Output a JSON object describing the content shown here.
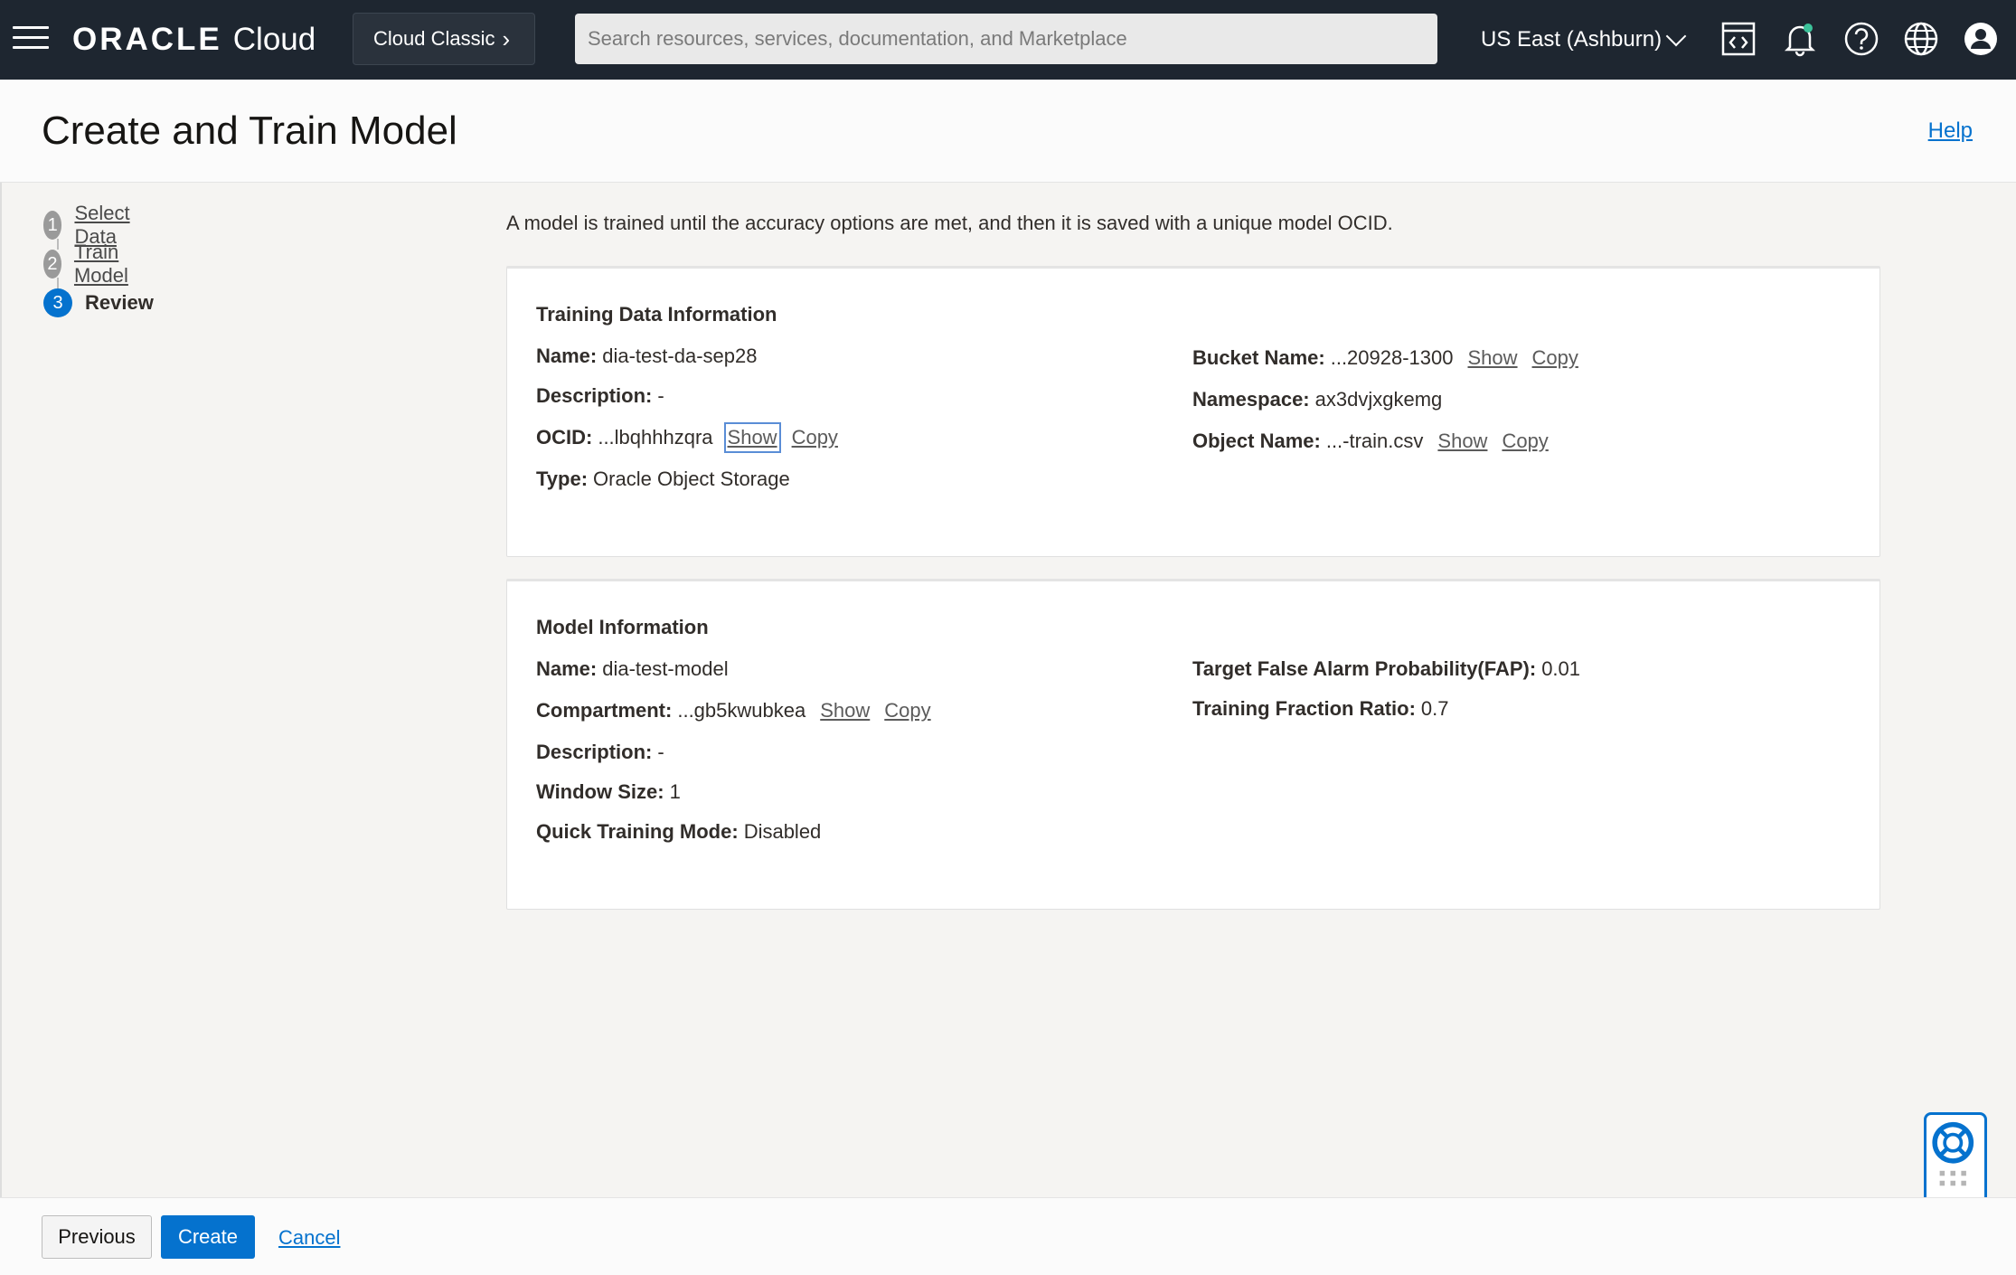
{
  "header": {
    "brand": "ORACLE",
    "product": "Cloud",
    "classic_label": "Cloud Classic",
    "search_placeholder": "Search resources, services, documentation, and Marketplace",
    "region": "US East (Ashburn)"
  },
  "page": {
    "title": "Create and Train Model",
    "help": "Help",
    "intro": "A model is trained until the accuracy options are met, and then it is saved with a unique model OCID."
  },
  "steps": [
    {
      "num": "1",
      "label": "Select Data"
    },
    {
      "num": "2",
      "label": "Train Model"
    },
    {
      "num": "3",
      "label": "Review"
    }
  ],
  "training_data": {
    "title": "Training Data Information",
    "name_k": "Name:",
    "name_v": "dia-test-da-sep28",
    "desc_k": "Description:",
    "desc_v": "-",
    "ocid_k": "OCID:",
    "ocid_v": "...lbqhhhzqra",
    "type_k": "Type:",
    "type_v": "Oracle Object Storage",
    "bucket_k": "Bucket Name:",
    "bucket_v": "...20928-1300",
    "ns_k": "Namespace:",
    "ns_v": "ax3dvjxgkemg",
    "obj_k": "Object Name:",
    "obj_v": "...-train.csv"
  },
  "model": {
    "title": "Model Information",
    "name_k": "Name:",
    "name_v": "dia-test-model",
    "comp_k": "Compartment:",
    "comp_v": "...gb5kwubkea",
    "desc_k": "Description:",
    "desc_v": "-",
    "win_k": "Window Size:",
    "win_v": "1",
    "quick_k": "Quick Training Mode:",
    "quick_v": "Disabled",
    "fap_k": "Target False Alarm Probability(FAP):",
    "fap_v": "0.01",
    "ratio_k": "Training Fraction Ratio:",
    "ratio_v": "0.7"
  },
  "links": {
    "show": "Show",
    "copy": "Copy"
  },
  "footer": {
    "previous": "Previous",
    "create": "Create",
    "cancel": "Cancel"
  },
  "colors": {
    "topbar": "#1e2630",
    "accent": "#0572ce"
  },
  "icons": [
    "menu-icon",
    "code-editor-icon",
    "bell-icon",
    "help-circle-icon",
    "globe-icon",
    "user-icon",
    "lifebuoy-icon"
  ]
}
